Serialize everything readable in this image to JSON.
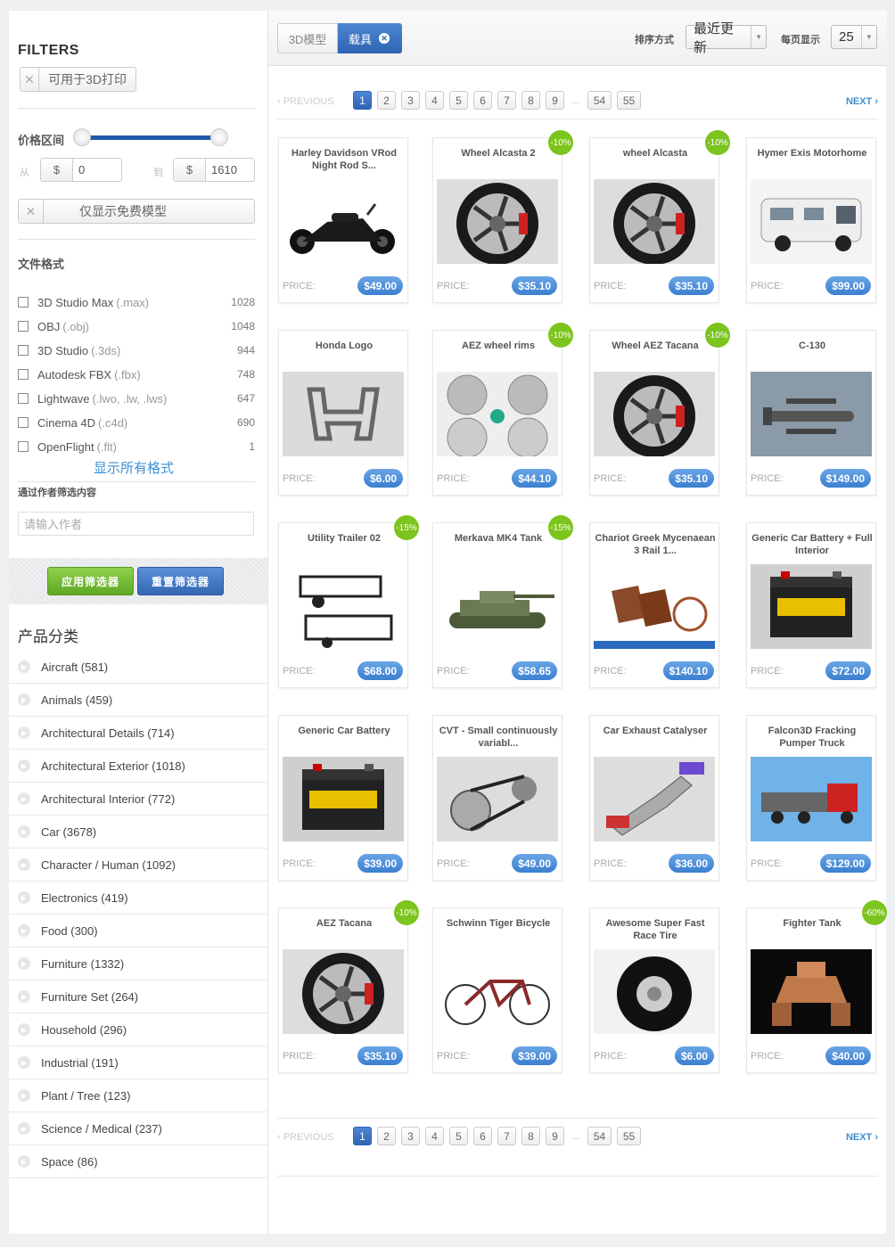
{
  "sidebar": {
    "title": "FILTERS",
    "print3d_chip": "可用于3D打印",
    "price_label": "价格区间",
    "from_label": "从",
    "to_label": "到",
    "currency": "$",
    "price_min": "0",
    "price_max": "1610",
    "free_chip": "仅显示免费模型",
    "format_label": "文件格式",
    "formats": [
      {
        "name": "3D Studio Max",
        "ext": "(.max)",
        "count": "1028"
      },
      {
        "name": "OBJ",
        "ext": "(.obj)",
        "count": "1048"
      },
      {
        "name": "3D Studio",
        "ext": "(.3ds)",
        "count": "944"
      },
      {
        "name": "Autodesk FBX",
        "ext": "(.fbx)",
        "count": "748"
      },
      {
        "name": "Lightwave",
        "ext": "(.lwo, .lw, .lws)",
        "count": "647"
      },
      {
        "name": "Cinema 4D",
        "ext": "(.c4d)",
        "count": "690"
      },
      {
        "name": "OpenFlight",
        "ext": "(.flt)",
        "count": "1"
      }
    ],
    "show_all_formats": "显示所有格式",
    "author_label": "通过作者筛选内容",
    "author_placeholder": "请输入作者",
    "apply_button": "应用筛选器",
    "reset_button": "重置筛选器",
    "category_title": "产品分类",
    "categories": [
      "Aircraft (581)",
      "Animals (459)",
      "Architectural Details (714)",
      "Architectural Exterior (1018)",
      "Architectural Interior (772)",
      "Car (3678)",
      "Character / Human (1092)",
      "Electronics (419)",
      "Food (300)",
      "Furniture (1332)",
      "Furniture Set (264)",
      "Household (296)",
      "Industrial (191)",
      "Plant / Tree (123)",
      "Science / Medical (237)",
      "Space (86)"
    ]
  },
  "topbar": {
    "crumb_root": "3D模型",
    "crumb_current": "载具",
    "sort_label": "排序方式",
    "sort_value": "最近更新",
    "per_page_label": "每页显示",
    "per_page_value": "25"
  },
  "pager": {
    "prev": "‹ PREVIOUS",
    "next": "NEXT ›",
    "pages": [
      "1",
      "2",
      "3",
      "4",
      "5",
      "6",
      "7",
      "8",
      "9"
    ],
    "ellipsis": "...",
    "last_pages": [
      "54",
      "55"
    ]
  },
  "price_label": "PRICE:",
  "products": [
    {
      "title": "Harley Davidson VRod Night Rod S...",
      "price": "$49.00",
      "badge": "",
      "icon": "motorcycle"
    },
    {
      "title": "Wheel Alcasta 2",
      "price": "$35.10",
      "badge": "-10%",
      "icon": "wheel"
    },
    {
      "title": "wheel Alcasta",
      "price": "$35.10",
      "badge": "-10%",
      "icon": "wheel"
    },
    {
      "title": "Hymer Exis Motorhome",
      "price": "$99.00",
      "badge": "",
      "icon": "motorhome"
    },
    {
      "title": "Honda Logo",
      "price": "$6.00",
      "badge": "",
      "icon": "logo"
    },
    {
      "title": "AEZ wheel rims",
      "price": "$44.10",
      "badge": "-10%",
      "icon": "rims"
    },
    {
      "title": "Wheel AEZ Tacana",
      "price": "$35.10",
      "badge": "-10%",
      "icon": "wheel"
    },
    {
      "title": "C-130",
      "price": "$149.00",
      "badge": "",
      "icon": "plane"
    },
    {
      "title": "Utility Trailer 02",
      "price": "$68.00",
      "badge": "-15%",
      "icon": "trailer"
    },
    {
      "title": "Merkava MK4 Tank",
      "price": "$58.65",
      "badge": "-15%",
      "icon": "tank"
    },
    {
      "title": "Chariot Greek Mycenaean 3 Rail 1...",
      "price": "$140.10",
      "badge": "",
      "icon": "chariot"
    },
    {
      "title": "Generic Car Battery + Full Interior",
      "price": "$72.00",
      "badge": "",
      "icon": "battery"
    },
    {
      "title": "Generic Car Battery",
      "price": "$39.00",
      "badge": "",
      "icon": "battery"
    },
    {
      "title": "CVT - Small continuously variabl...",
      "price": "$49.00",
      "badge": "",
      "icon": "cvt"
    },
    {
      "title": "Car Exhaust Catalyser",
      "price": "$36.00",
      "badge": "",
      "icon": "exhaust"
    },
    {
      "title": "Falcon3D Fracking Pumper Truck",
      "price": "$129.00",
      "badge": "",
      "icon": "truck"
    },
    {
      "title": "AEZ Tacana",
      "price": "$35.10",
      "badge": "-10%",
      "icon": "wheel"
    },
    {
      "title": "Schwinn Tiger Bicycle",
      "price": "$39.00",
      "badge": "",
      "icon": "bicycle"
    },
    {
      "title": "Awesome Super Fast Race Tire",
      "price": "$6.00",
      "badge": "",
      "icon": "tire"
    },
    {
      "title": "Fighter Tank",
      "price": "$40.00",
      "badge": "-60%",
      "icon": "robot"
    }
  ],
  "colors": {
    "accent": "#2f65b3",
    "badge": "#7cc41e",
    "price": "#3a7fd0",
    "apply": "#5fa825"
  }
}
